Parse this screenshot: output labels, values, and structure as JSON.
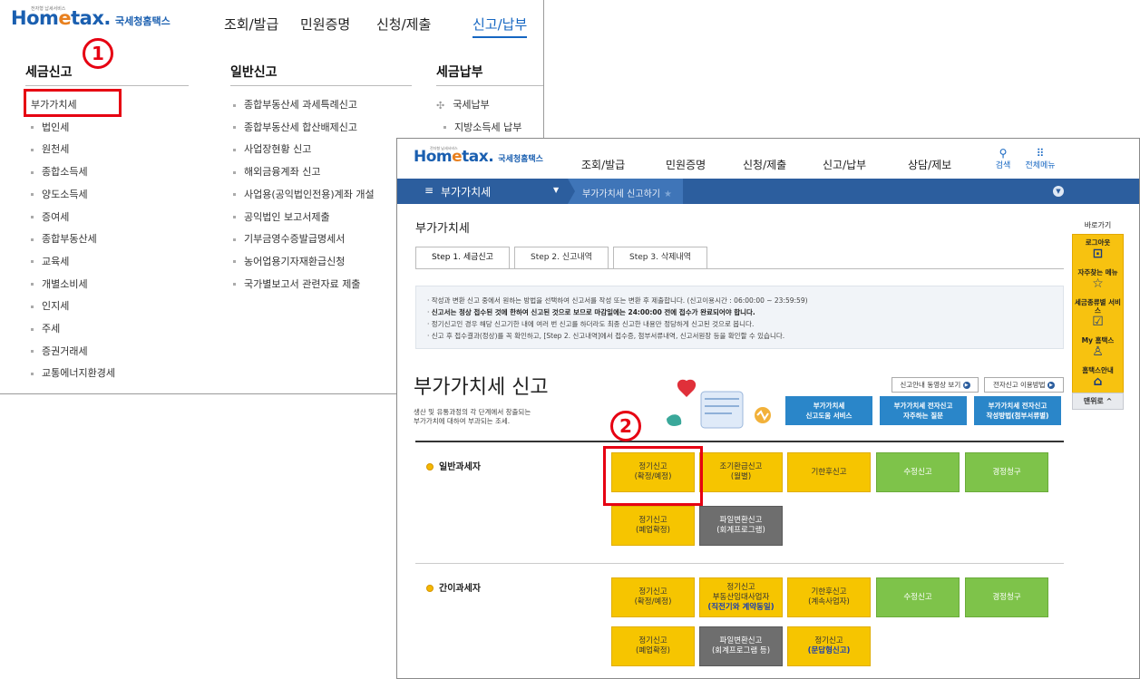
{
  "back": {
    "logo": {
      "tiny": "전자형 납세서비스",
      "main_a": "Hom",
      "main_e": "e",
      "main_b": "tax.",
      "sub": "국세청홈택스"
    },
    "menu": [
      "조회/발급",
      "민원증명",
      "신청/제출",
      "신고/납부"
    ],
    "col1": {
      "title": "세금신고",
      "items": [
        "부가가치세",
        "법인세",
        "원천세",
        "종합소득세",
        "양도소득세",
        "증여세",
        "종합부동산세",
        "교육세",
        "개별소비세",
        "인지세",
        "주세",
        "증권거래세",
        "교통에너지환경세"
      ]
    },
    "col2": {
      "title": "일반신고",
      "items": [
        "종합부동산세 과세특례신고",
        "종합부동산세 합산배제신고",
        "사업장현황 신고",
        "해외금융계좌 신고",
        "사업용(공익법인전용)계좌 개설",
        "공익법인 보고서제출",
        "기부금영수증발급명세서",
        "농어업용기자재환급신청",
        "국가별보고서 관련자료 제출"
      ]
    },
    "col3": {
      "title": "세금납부",
      "items": [
        "국세납부",
        "지방소득세 납부"
      ]
    },
    "callout1": "1"
  },
  "front": {
    "menu": [
      "조회/발급",
      "민원증명",
      "신청/제출",
      "신고/납부",
      "상담/제보"
    ],
    "tools": [
      {
        "icon": "⚲",
        "label": "검색"
      },
      {
        "icon": "⠿",
        "label": "전체메뉴"
      }
    ],
    "nav": {
      "title": "부가가치세",
      "crumb": "부가가치세 신고하기",
      "star": "★"
    },
    "page_title": "부가가치세",
    "tabs": [
      "Step 1. 세금신고",
      "Step 2. 신고내역",
      "Step 3. 삭제내역"
    ],
    "info": [
      "작성과 변환 신고 중에서 원하는 방법을 선택하여 신고서를 작성 또는 변환 후 제출합니다. (신고이용시간 : 06:00:00 ~ 23:59:59)",
      "신고서는 정상 접수된 것에 한하여 신고된 것으로 보므로 마감일에는 24:00:00 전에 접수가 완료되어야 합니다.",
      "정기신고인 경우 해당 신고기한 내에 여러 번 신고를 하더라도 최종 신고한 내용만 정당하게 신고된 것으로 봅니다.",
      "신고 후 접수결과(정상)를 꼭 확인하고, [Step 2. 신고내역]에서 접수증, 첨부서류내역, 신고서원장 등을 확인할 수 있습니다."
    ],
    "big_title": "부가가치세 신고",
    "desc": [
      "생산 및 유통과정의 각 단계에서 창출되는",
      "부가가치에 대하여 부과되는 조세."
    ],
    "small_btns": [
      "신고안내 동영상 보기",
      "전자신고 이용방법"
    ],
    "blue_btns": [
      [
        "부가가치세",
        "신고도움 서비스"
      ],
      [
        "부가가치세 전자신고",
        "자주하는 질문"
      ],
      [
        "부가가치세 전자신고",
        "작성방법(첨부서류별)"
      ]
    ],
    "general": {
      "label": "일반과세자",
      "btns": [
        [
          "정기신고",
          "(확정/예정)"
        ],
        [
          "조기환급신고",
          "(월별)"
        ],
        [
          "기한후신고"
        ],
        [
          "수정신고"
        ],
        [
          "경정청구"
        ],
        [
          "정기신고",
          "(폐업확정)"
        ],
        [
          "파일변환신고",
          "(회계프로그램)"
        ]
      ]
    },
    "simple": {
      "label": "간이과세자",
      "btns": [
        [
          "정기신고",
          "(확정/예정)"
        ],
        [
          "정기신고",
          "부동산임대사업자",
          "(직전기와 계약동일)"
        ],
        [
          "기한후신고",
          "(계속사업자)"
        ],
        [
          "수정신고"
        ],
        [
          "경정청구"
        ],
        [
          "정기신고",
          "(폐업확정)"
        ],
        [
          "파일변환신고",
          "(회계프로그램 등)"
        ],
        [
          "정기신고",
          "(문답형신고)"
        ]
      ]
    },
    "sidebar": {
      "head": "바로가기",
      "items": [
        {
          "label": "로그아웃",
          "icon": "🔓"
        },
        {
          "label": "자주찾는 메뉴",
          "icon": "☆"
        },
        {
          "label": "세금종류별 서비스",
          "icon": "☑"
        },
        {
          "label": "My 홈택스",
          "icon": "♙"
        },
        {
          "label": "홈택스안내",
          "icon": "⌂"
        }
      ],
      "top": "맨위로"
    },
    "callout2": "2"
  }
}
